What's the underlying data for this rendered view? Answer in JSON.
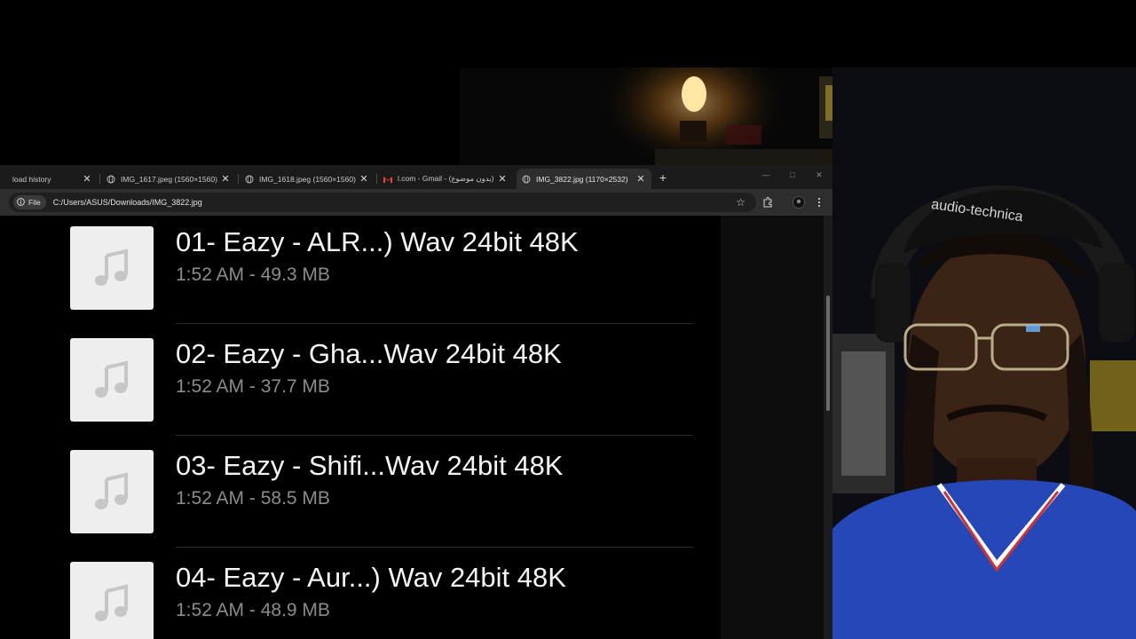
{
  "browser": {
    "tabs": [
      {
        "title": "load history",
        "active": false,
        "favicon": "download-icon"
      },
      {
        "title": "IMG_1617.jpeg (1560×1560)",
        "active": false,
        "favicon": "globe-icon"
      },
      {
        "title": "IMG_1618.jpeg (1560×1560)",
        "active": false,
        "favicon": "globe-icon"
      },
      {
        "title": "l.com - Gmail - (بدون موضوع)",
        "active": false,
        "favicon": "gmail-icon"
      },
      {
        "title": "IMG_3822.jpg (1170×2532)",
        "active": true,
        "favicon": "globe-icon"
      }
    ],
    "close_glyph": "✕",
    "new_tab_glyph": "+",
    "window_controls": {
      "minimize": "—",
      "maximize": "□",
      "close": "✕"
    },
    "address_bar": {
      "chip_label": "File",
      "url": "C:/Users/ASUS/Downloads/IMG_3822.jpg"
    }
  },
  "files": [
    {
      "name": "01- Eazy - ALR...) Wav 24bit 48K",
      "meta": "1:52 AM - 49.3 MB"
    },
    {
      "name": "02- Eazy - Gha...Wav 24bit 48K",
      "meta": "1:52 AM - 37.7 MB"
    },
    {
      "name": "03- Eazy - Shifi...Wav 24bit 48K",
      "meta": "1:52 AM - 58.5 MB"
    },
    {
      "name": "04- Eazy - Aur...) Wav 24bit 48K",
      "meta": "1:52 AM - 48.9 MB"
    }
  ],
  "colors": {
    "page_background": "#000000",
    "file_name": "#f4f4f4",
    "file_meta": "#8b8b8b",
    "thumbnail_bg": "#eeeeee",
    "music_note": "#c6c6c6",
    "jersey_blue": "#2547b8"
  },
  "webcam": {
    "headphone_brand": "audio-technica"
  }
}
